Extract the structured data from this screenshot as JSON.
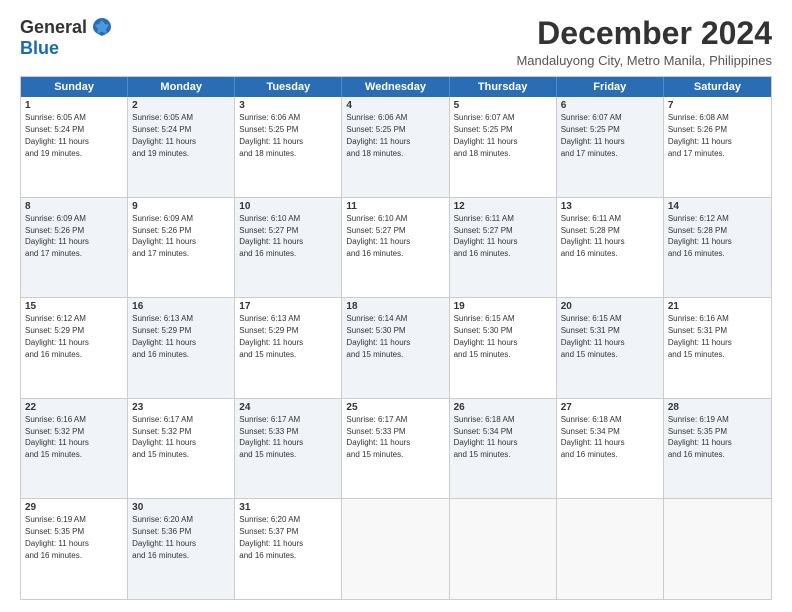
{
  "logo": {
    "general": "General",
    "blue": "Blue"
  },
  "title": "December 2024",
  "subtitle": "Mandaluyong City, Metro Manila, Philippines",
  "header_days": [
    "Sunday",
    "Monday",
    "Tuesday",
    "Wednesday",
    "Thursday",
    "Friday",
    "Saturday"
  ],
  "weeks": [
    [
      {
        "day": "1",
        "info": "Sunrise: 6:05 AM\nSunset: 5:24 PM\nDaylight: 11 hours\nand 19 minutes.",
        "shaded": false
      },
      {
        "day": "2",
        "info": "Sunrise: 6:05 AM\nSunset: 5:24 PM\nDaylight: 11 hours\nand 19 minutes.",
        "shaded": true
      },
      {
        "day": "3",
        "info": "Sunrise: 6:06 AM\nSunset: 5:25 PM\nDaylight: 11 hours\nand 18 minutes.",
        "shaded": false
      },
      {
        "day": "4",
        "info": "Sunrise: 6:06 AM\nSunset: 5:25 PM\nDaylight: 11 hours\nand 18 minutes.",
        "shaded": true
      },
      {
        "day": "5",
        "info": "Sunrise: 6:07 AM\nSunset: 5:25 PM\nDaylight: 11 hours\nand 18 minutes.",
        "shaded": false
      },
      {
        "day": "6",
        "info": "Sunrise: 6:07 AM\nSunset: 5:25 PM\nDaylight: 11 hours\nand 17 minutes.",
        "shaded": true
      },
      {
        "day": "7",
        "info": "Sunrise: 6:08 AM\nSunset: 5:26 PM\nDaylight: 11 hours\nand 17 minutes.",
        "shaded": false
      }
    ],
    [
      {
        "day": "8",
        "info": "Sunrise: 6:09 AM\nSunset: 5:26 PM\nDaylight: 11 hours\nand 17 minutes.",
        "shaded": true
      },
      {
        "day": "9",
        "info": "Sunrise: 6:09 AM\nSunset: 5:26 PM\nDaylight: 11 hours\nand 17 minutes.",
        "shaded": false
      },
      {
        "day": "10",
        "info": "Sunrise: 6:10 AM\nSunset: 5:27 PM\nDaylight: 11 hours\nand 16 minutes.",
        "shaded": true
      },
      {
        "day": "11",
        "info": "Sunrise: 6:10 AM\nSunset: 5:27 PM\nDaylight: 11 hours\nand 16 minutes.",
        "shaded": false
      },
      {
        "day": "12",
        "info": "Sunrise: 6:11 AM\nSunset: 5:27 PM\nDaylight: 11 hours\nand 16 minutes.",
        "shaded": true
      },
      {
        "day": "13",
        "info": "Sunrise: 6:11 AM\nSunset: 5:28 PM\nDaylight: 11 hours\nand 16 minutes.",
        "shaded": false
      },
      {
        "day": "14",
        "info": "Sunrise: 6:12 AM\nSunset: 5:28 PM\nDaylight: 11 hours\nand 16 minutes.",
        "shaded": true
      }
    ],
    [
      {
        "day": "15",
        "info": "Sunrise: 6:12 AM\nSunset: 5:29 PM\nDaylight: 11 hours\nand 16 minutes.",
        "shaded": false
      },
      {
        "day": "16",
        "info": "Sunrise: 6:13 AM\nSunset: 5:29 PM\nDaylight: 11 hours\nand 16 minutes.",
        "shaded": true
      },
      {
        "day": "17",
        "info": "Sunrise: 6:13 AM\nSunset: 5:29 PM\nDaylight: 11 hours\nand 15 minutes.",
        "shaded": false
      },
      {
        "day": "18",
        "info": "Sunrise: 6:14 AM\nSunset: 5:30 PM\nDaylight: 11 hours\nand 15 minutes.",
        "shaded": true
      },
      {
        "day": "19",
        "info": "Sunrise: 6:15 AM\nSunset: 5:30 PM\nDaylight: 11 hours\nand 15 minutes.",
        "shaded": false
      },
      {
        "day": "20",
        "info": "Sunrise: 6:15 AM\nSunset: 5:31 PM\nDaylight: 11 hours\nand 15 minutes.",
        "shaded": true
      },
      {
        "day": "21",
        "info": "Sunrise: 6:16 AM\nSunset: 5:31 PM\nDaylight: 11 hours\nand 15 minutes.",
        "shaded": false
      }
    ],
    [
      {
        "day": "22",
        "info": "Sunrise: 6:16 AM\nSunset: 5:32 PM\nDaylight: 11 hours\nand 15 minutes.",
        "shaded": true
      },
      {
        "day": "23",
        "info": "Sunrise: 6:17 AM\nSunset: 5:32 PM\nDaylight: 11 hours\nand 15 minutes.",
        "shaded": false
      },
      {
        "day": "24",
        "info": "Sunrise: 6:17 AM\nSunset: 5:33 PM\nDaylight: 11 hours\nand 15 minutes.",
        "shaded": true
      },
      {
        "day": "25",
        "info": "Sunrise: 6:17 AM\nSunset: 5:33 PM\nDaylight: 11 hours\nand 15 minutes.",
        "shaded": false
      },
      {
        "day": "26",
        "info": "Sunrise: 6:18 AM\nSunset: 5:34 PM\nDaylight: 11 hours\nand 15 minutes.",
        "shaded": true
      },
      {
        "day": "27",
        "info": "Sunrise: 6:18 AM\nSunset: 5:34 PM\nDaylight: 11 hours\nand 16 minutes.",
        "shaded": false
      },
      {
        "day": "28",
        "info": "Sunrise: 6:19 AM\nSunset: 5:35 PM\nDaylight: 11 hours\nand 16 minutes.",
        "shaded": true
      }
    ],
    [
      {
        "day": "29",
        "info": "Sunrise: 6:19 AM\nSunset: 5:35 PM\nDaylight: 11 hours\nand 16 minutes.",
        "shaded": false
      },
      {
        "day": "30",
        "info": "Sunrise: 6:20 AM\nSunset: 5:36 PM\nDaylight: 11 hours\nand 16 minutes.",
        "shaded": true
      },
      {
        "day": "31",
        "info": "Sunrise: 6:20 AM\nSunset: 5:37 PM\nDaylight: 11 hours\nand 16 minutes.",
        "shaded": false
      },
      {
        "day": "",
        "info": "",
        "empty": true
      },
      {
        "day": "",
        "info": "",
        "empty": true
      },
      {
        "day": "",
        "info": "",
        "empty": true
      },
      {
        "day": "",
        "info": "",
        "empty": true
      }
    ]
  ]
}
